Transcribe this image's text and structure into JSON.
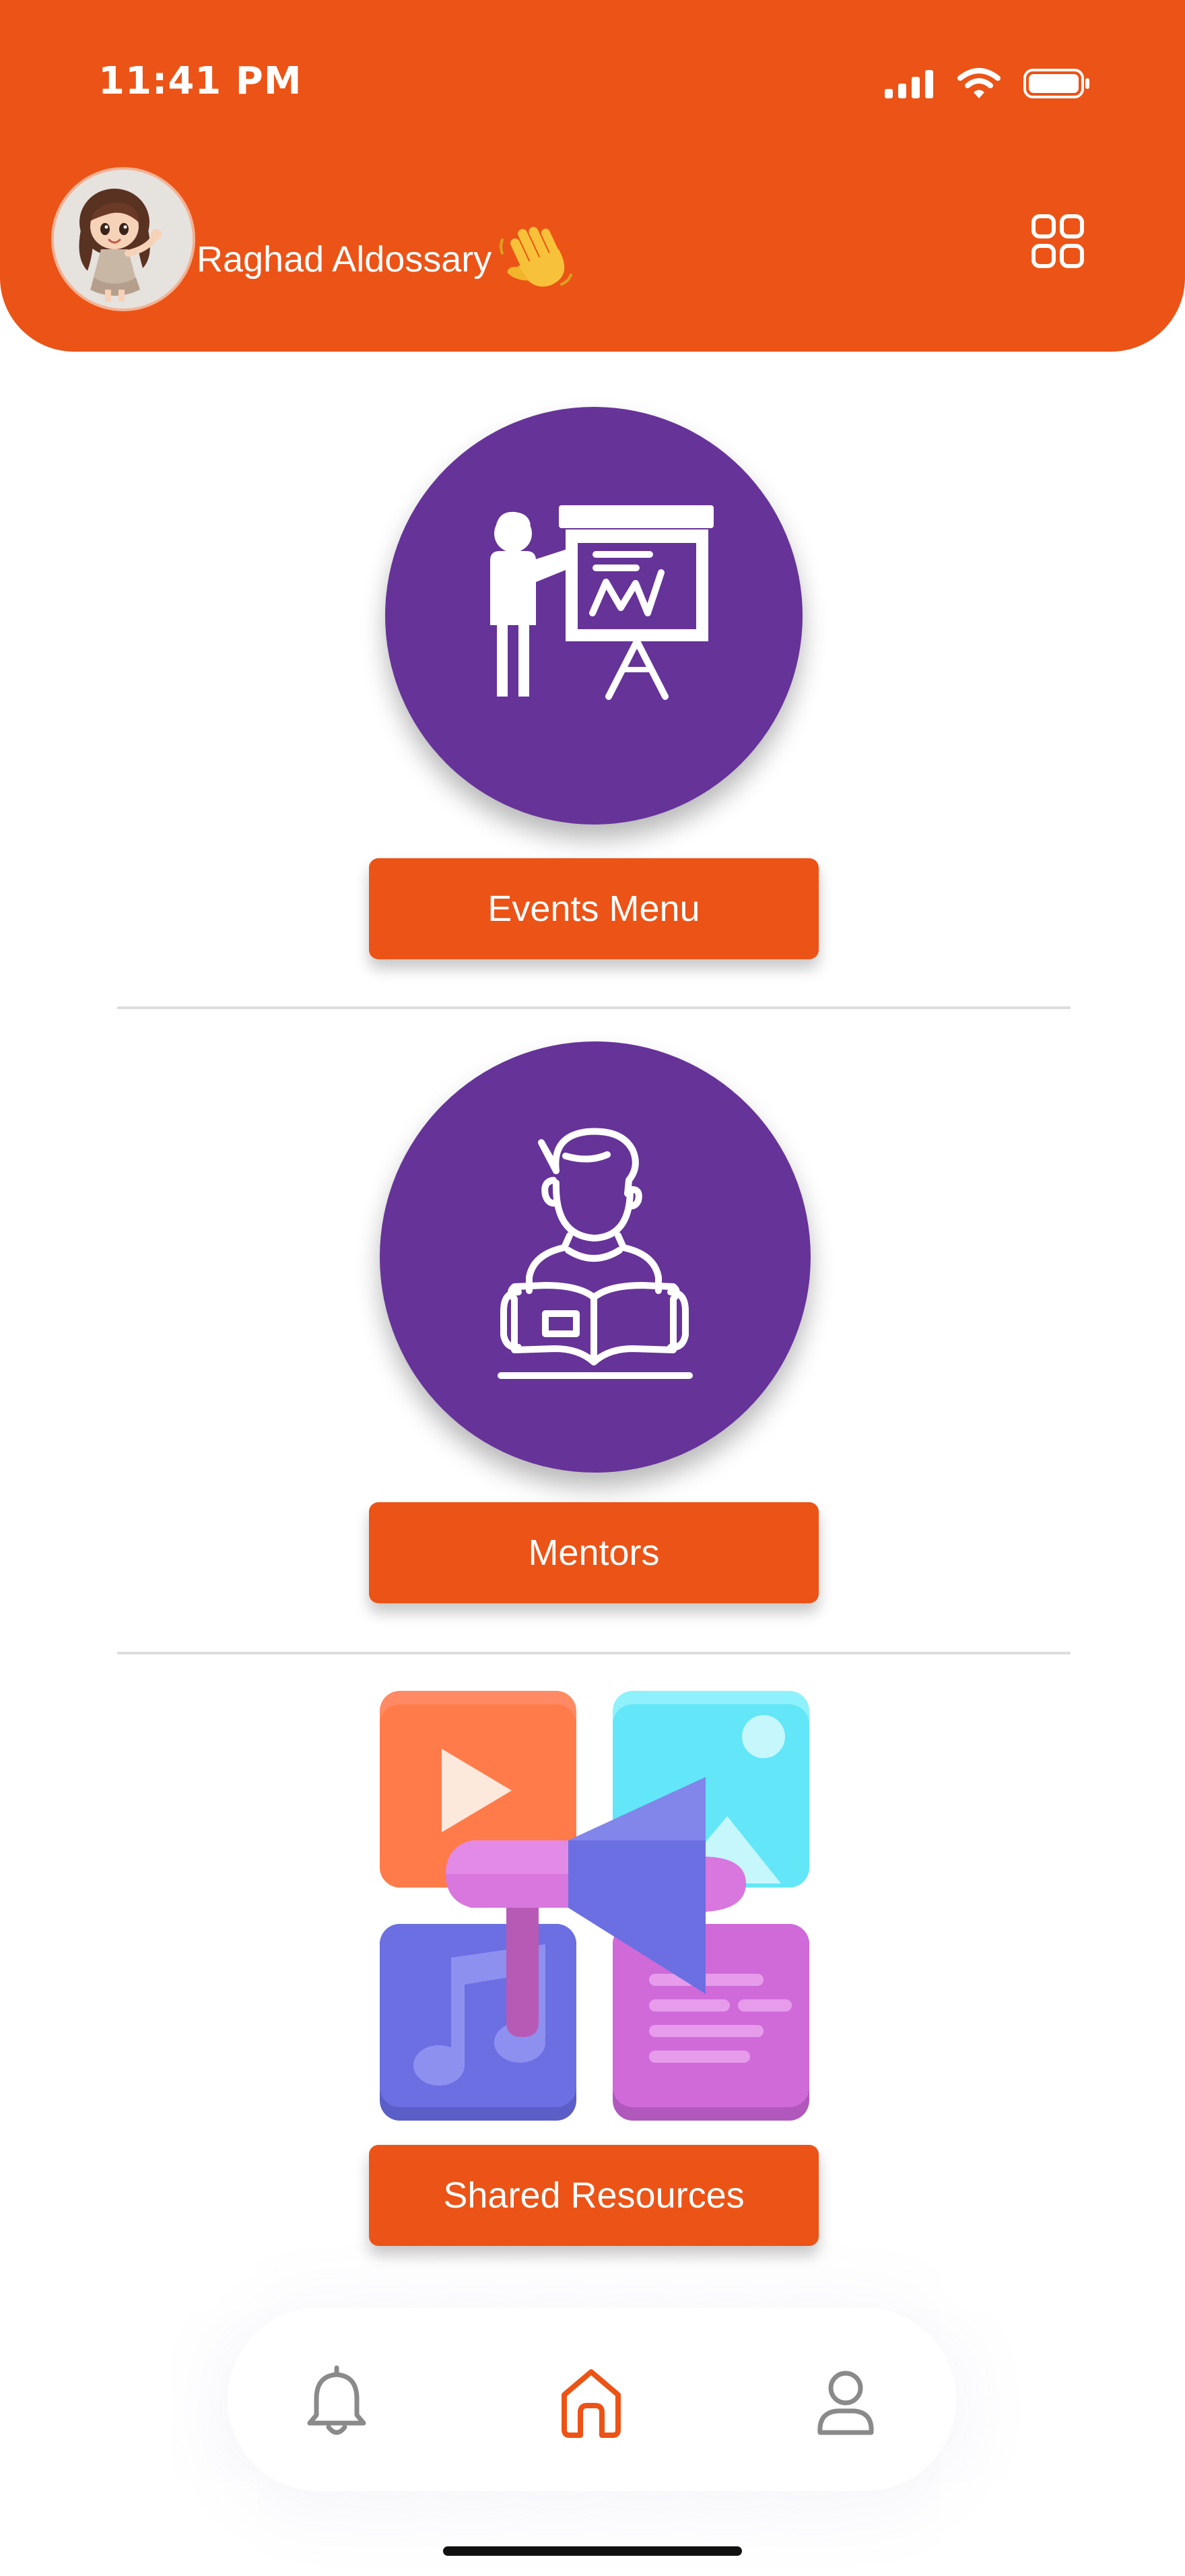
{
  "status_bar": {
    "time": "11:41 PM"
  },
  "header": {
    "user_name": "Raghad Aldossary",
    "greeting_icon": "waving-hand-icon",
    "menu_icon": "grid-icon"
  },
  "sections": [
    {
      "icon": "presentation-icon",
      "button_label": "Events Menu"
    },
    {
      "icon": "mentor-reading-icon",
      "button_label": "Mentors"
    },
    {
      "icon": "media-megaphone-icon",
      "button_label": "Shared Resources"
    }
  ],
  "bottom_nav": {
    "items": [
      {
        "icon": "bell-icon",
        "active": false
      },
      {
        "icon": "home-icon",
        "active": true
      },
      {
        "icon": "user-icon",
        "active": false
      }
    ]
  },
  "colors": {
    "brand_orange": "#ec5316",
    "circle_purple": "#663399",
    "nav_inactive": "#8a8a8a"
  }
}
